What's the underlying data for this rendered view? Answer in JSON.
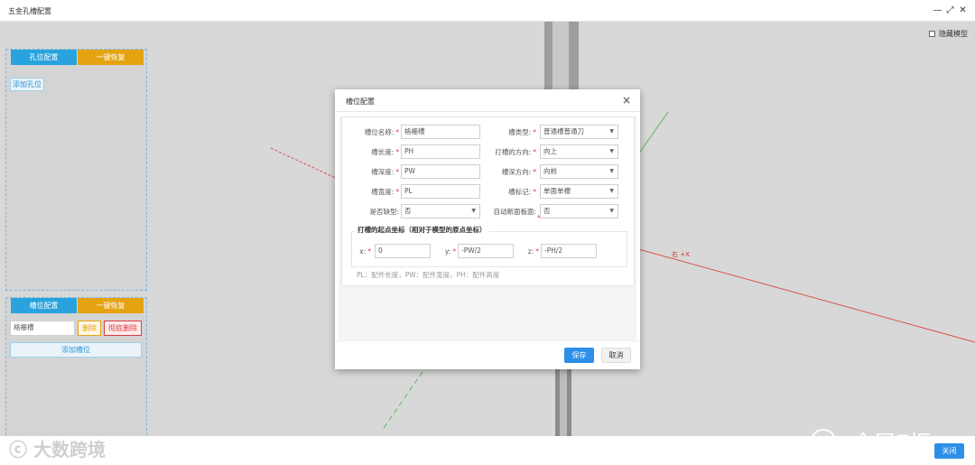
{
  "window": {
    "title": "五金孔槽配置"
  },
  "viewport": {
    "hide_model_label": "隐藏模型",
    "axis_label": "右 +X"
  },
  "hole_panel": {
    "tab_config": "孔位配置",
    "tab_restore": "一键恢复",
    "add_hole": "添加孔位"
  },
  "slot_panel": {
    "tab_config": "槽位配置",
    "tab_restore": "一键恢复",
    "slot_name": "格栅槽",
    "delete": "删除",
    "delete_all": "彻底删除",
    "add_slot": "添加槽位"
  },
  "dialog": {
    "title": "槽位配置",
    "close": "×",
    "fields": {
      "slot_name_label": "槽位名称:",
      "slot_name_value": "格栅槽",
      "slot_type_label": "槽类型:",
      "slot_type_value": "普通槽普通刀",
      "length_label": "槽长度:",
      "length_value": "PH",
      "direction_label": "打槽的方向:",
      "direction_value": "向上",
      "depth_label": "槽深度:",
      "depth_value": "PW",
      "depth_dir_label": "槽深方向:",
      "depth_dir_value": "向前",
      "width_label": "槽宽度:",
      "width_value": "PL",
      "mark_label": "槽标记:",
      "mark_value": "单面单槽",
      "notch_label": "是否缺型:",
      "notch_value": "否",
      "auto_label": "自动断面板面:",
      "auto_value": "否"
    },
    "origin": {
      "title": "打槽的起点坐标（相对于模型的原点坐标）",
      "x_label": "x:",
      "x_value": "0",
      "y_label": "y:",
      "y_value": "-PW/2",
      "z_label": "z:",
      "z_value": "-PH/2"
    },
    "note": "PL：配件长度，PW：配件宽度，PH：配件高度",
    "save": "保存",
    "cancel": "取消"
  },
  "bottom": {
    "close": "关闭"
  },
  "watermarks": {
    "left": "大数跨境",
    "right": "全屋E柜"
  },
  "colors": {
    "primary": "#2d8fe8",
    "tab_blue": "#29a3dd",
    "tab_orange": "#e5a312",
    "required": "#e23b3b"
  }
}
